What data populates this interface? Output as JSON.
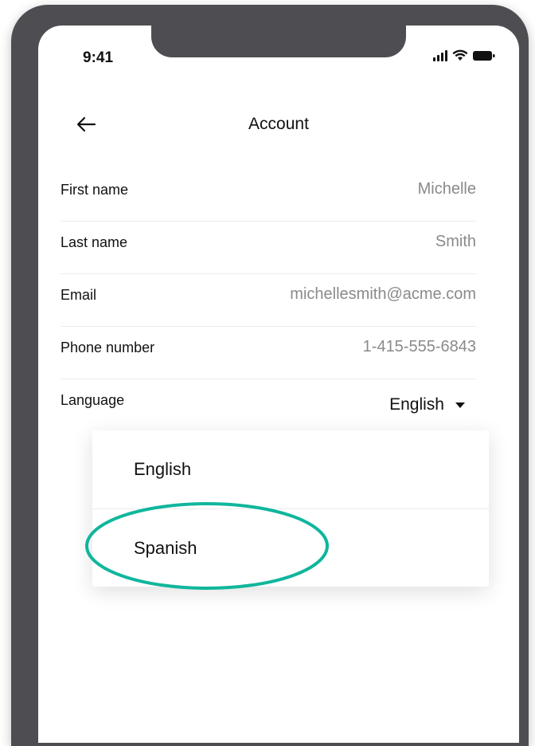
{
  "status_bar": {
    "time": "9:41"
  },
  "header": {
    "title": "Account"
  },
  "fields": [
    {
      "label": "First name",
      "value": "Michelle"
    },
    {
      "label": "Last name",
      "value": "Smith"
    },
    {
      "label": "Email",
      "value": "michellesmith@acme.com"
    },
    {
      "label": "Phone number",
      "value": "1-415-555-6843"
    }
  ],
  "language": {
    "label": "Language",
    "selected": "English"
  },
  "dropdown": {
    "options": [
      "English",
      "Spanish"
    ]
  },
  "colors": {
    "highlight": "#0fb69c",
    "frame": "#4d4d52",
    "value_text": "#8a8a8a"
  }
}
